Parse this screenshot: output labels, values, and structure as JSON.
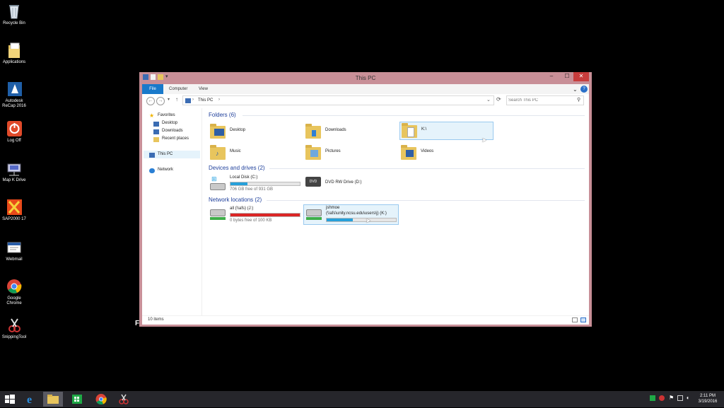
{
  "desktop": {
    "icons": [
      {
        "label": "Recycle Bin",
        "icon": "recycle-bin-icon"
      },
      {
        "label": "Applications",
        "icon": "applications-folder-icon"
      },
      {
        "label": "Autodesk ReCap 2016",
        "icon": "autodesk-recap-icon"
      },
      {
        "label": "Log Off",
        "icon": "log-off-icon"
      },
      {
        "label": "Map K Drive",
        "icon": "map-drive-icon"
      },
      {
        "label": "SAP2000 17",
        "icon": "sap2000-icon"
      },
      {
        "label": "Webmail",
        "icon": "webmail-icon"
      },
      {
        "label": "Google Chrome",
        "icon": "chrome-icon"
      },
      {
        "label": "SnippingTool",
        "icon": "snipping-tool-icon"
      }
    ],
    "stray_text": "F"
  },
  "window": {
    "title": "This PC",
    "controls": {
      "minimize": "–",
      "maximize": "☐",
      "close": "✕"
    },
    "ribbon": {
      "file": "File",
      "computer": "Computer",
      "view": "View",
      "expand": "⌄",
      "help": "?"
    },
    "address": {
      "path_root": "This PC",
      "sep": "›",
      "dropdown": "⌄",
      "refresh": "⟳"
    },
    "search": {
      "placeholder": "Search This PC"
    },
    "nav": {
      "favorites": "Favorites",
      "desktop": "Desktop",
      "downloads": "Downloads",
      "recent": "Recent places",
      "this_pc": "This PC",
      "network": "Network"
    },
    "sections": {
      "folders": "Folders (6)",
      "devices": "Devices and drives (2)",
      "network": "Network locations (2)"
    },
    "folders": [
      "Desktop",
      "Downloads",
      "K:\\",
      "Music",
      "Pictures",
      "Videos"
    ],
    "drives": [
      {
        "name": "Local Disk (C:)",
        "free": "706 GB free of 931 GB",
        "used_fraction": 0.24,
        "bar_color": "#26a0da"
      },
      {
        "name": "DVD RW Drive (D:)",
        "badge": "DVD"
      }
    ],
    "network_locations": [
      {
        "name": "all (\\\\afs) (J:)",
        "free": "0 bytes free of 100 KB",
        "used_fraction": 1.0,
        "bar_color": "#da2626"
      },
      {
        "name_line1": "jshmoe",
        "name_line2": "(\\\\afs\\unity.ncsu.edu\\users\\j) (K:)",
        "used_fraction": 0.38,
        "bar_color": "#26a0da"
      }
    ],
    "status": "10 items"
  },
  "taskbar": {
    "clock_time": "2:11 PM",
    "clock_date": "3/19/2016"
  },
  "colors": {
    "selection_bg": "#e5f3fb",
    "selection_border": "#99c9ef",
    "title_bar": "#c88f97",
    "close_button": "#c73c3c",
    "taskbar": "#26262b"
  }
}
